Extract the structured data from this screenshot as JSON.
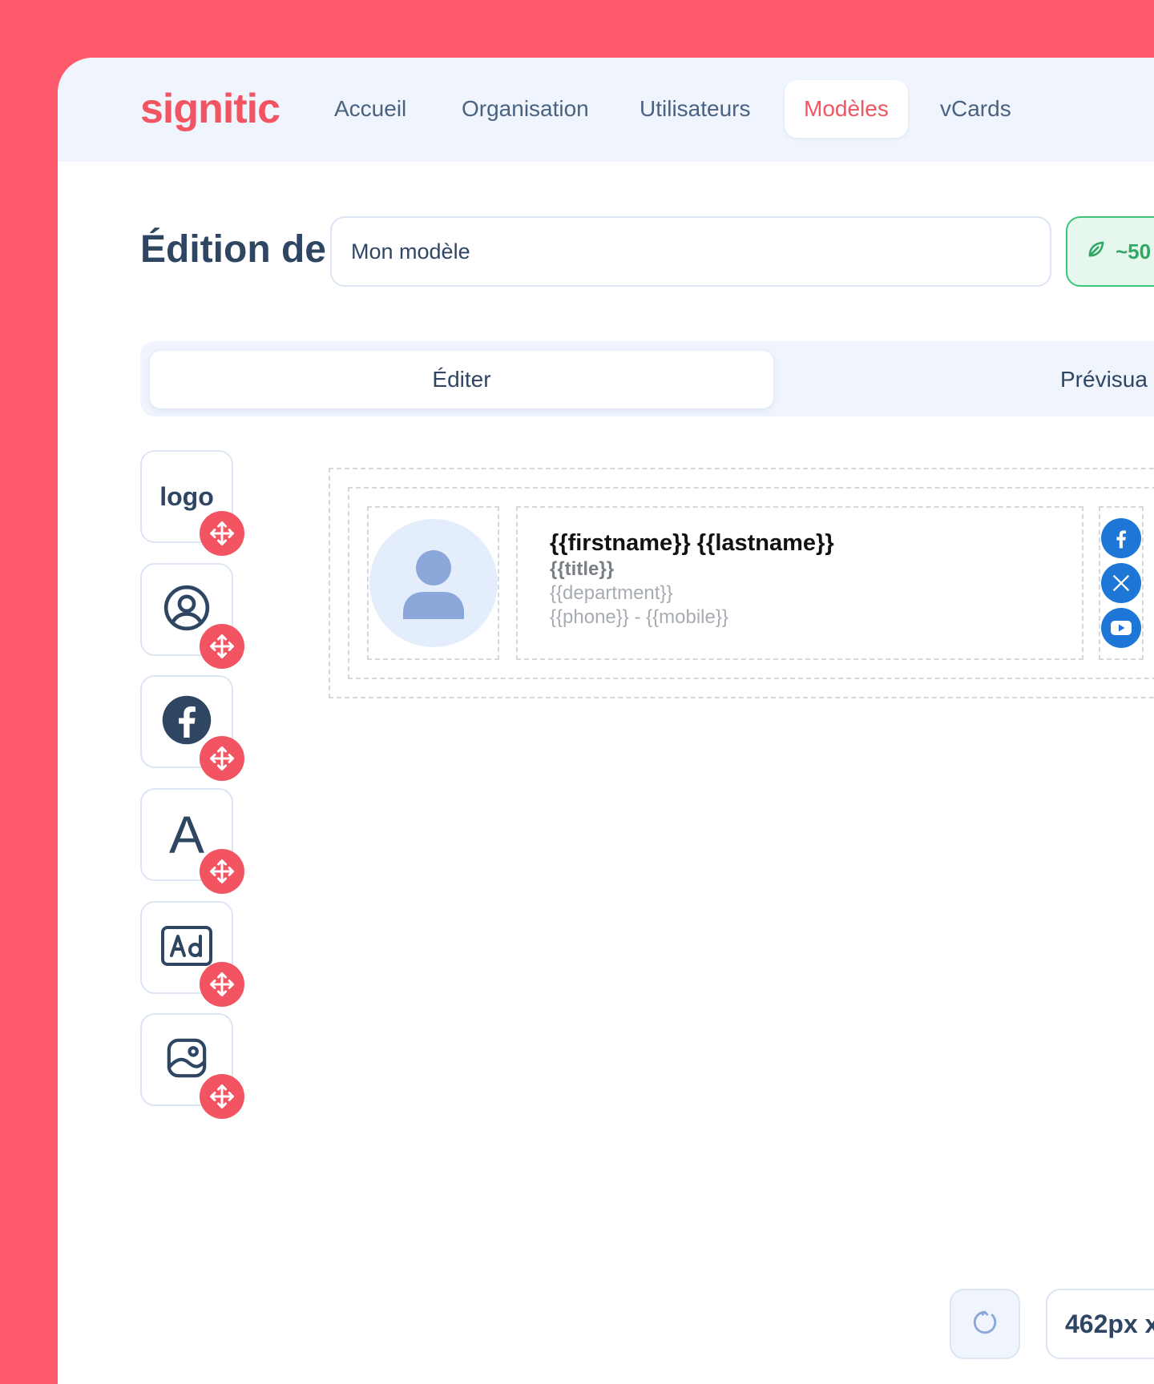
{
  "app": {
    "logo_text": "signitic"
  },
  "nav": {
    "items": [
      {
        "label": "Accueil"
      },
      {
        "label": "Organisation"
      },
      {
        "label": "Utilisateurs"
      },
      {
        "label": "Modèles",
        "active": true
      },
      {
        "label": "vCards"
      }
    ]
  },
  "editor": {
    "title": "Édition de",
    "name_value": "Mon modèle",
    "eco_badge": "~50",
    "tabs": [
      {
        "label": "Éditer",
        "active": true
      },
      {
        "label": "Prévisua"
      }
    ],
    "size_label": "462px x"
  },
  "tools": [
    {
      "name": "logo",
      "label": "logo",
      "icon": "logo-text"
    },
    {
      "name": "avatar",
      "icon": "user-circle-icon"
    },
    {
      "name": "facebook",
      "icon": "facebook-icon"
    },
    {
      "name": "text",
      "icon": "text-icon",
      "letter": "A"
    },
    {
      "name": "ad",
      "icon": "ad-icon"
    },
    {
      "name": "image",
      "icon": "image-icon"
    }
  ],
  "signature": {
    "name": "{{firstname}} {{lastname}}",
    "title": "{{title}}",
    "department": "{{department}}",
    "phone": "{{phone}} - {{mobile}}",
    "social": [
      "facebook-icon",
      "x-icon",
      "youtube-icon"
    ]
  },
  "colors": {
    "brand": "#F25462",
    "background": "#FF5A6B",
    "text_dark": "#2F4663",
    "eco_green": "#2FA865",
    "social_blue": "#1E77D6"
  }
}
